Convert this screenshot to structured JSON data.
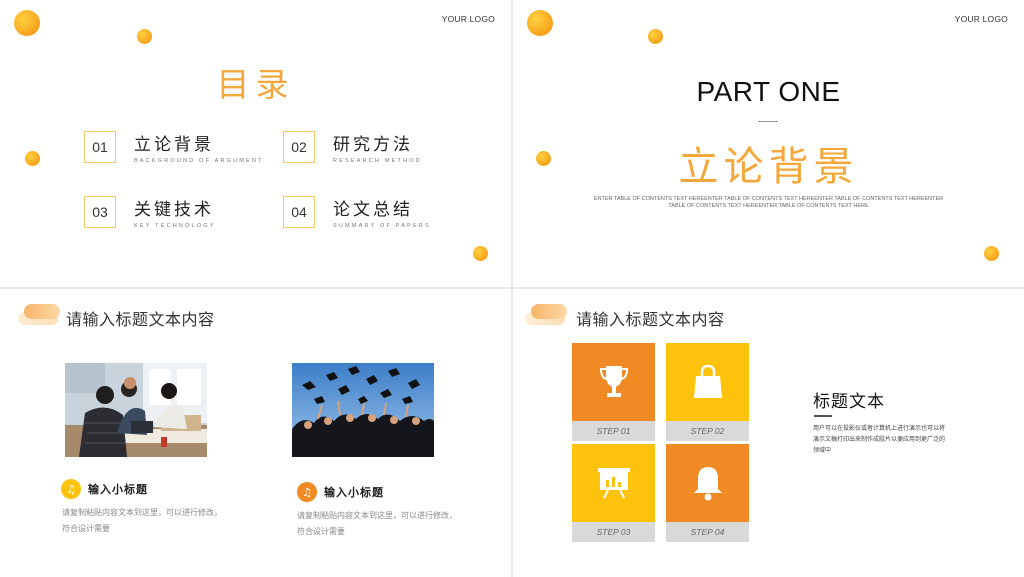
{
  "logo_text": "YOUR LOGO",
  "colors": {
    "accent": "#f4a73b",
    "orange": "#f08a24",
    "yellow": "#fdc20b",
    "grey_label": "#d9d9d9"
  },
  "slide1": {
    "title": "目录",
    "items": [
      {
        "num": "01",
        "label": "立论背景",
        "sub": "BACKGROUND OF ARGUMENT"
      },
      {
        "num": "02",
        "label": "研究方法",
        "sub": "RESEARCH METHOD"
      },
      {
        "num": "03",
        "label": "关键技术",
        "sub": "KEY TECHNOLOGY"
      },
      {
        "num": "04",
        "label": "论文总结",
        "sub": "SUMMARY OF PAPERS"
      }
    ]
  },
  "slide2": {
    "part": "PART ONE",
    "title": "立论背景",
    "desc": "ENTER TABLE OF CONTENTS TEXT HEREENTER TABLE OF CONTENTS TEXT HEREENTER TABLE OF CONTENTS TEXT HEREENTER TABLE OF CONTENTS TEXT HEREENTER TABLE OF CONTENTS TEXT HERE"
  },
  "slide3": {
    "header": "请输入标题文本内容",
    "cards": [
      {
        "icon": "music-note-icon",
        "title": "输入小标题",
        "desc": "请复制粘贴内容文本到这里，可以进行修改，符合设计需要"
      },
      {
        "icon": "music-note-icon",
        "title": "输入小标题",
        "desc": "请复制粘贴内容文本到这里，可以进行修改，符合设计需要"
      }
    ]
  },
  "slide4": {
    "header": "请输入标题文本内容",
    "steps": [
      {
        "label": "STEP 01",
        "icon": "trophy-icon"
      },
      {
        "label": "STEP 02",
        "icon": "shopping-bag-icon"
      },
      {
        "label": "STEP 03",
        "icon": "presentation-board-icon"
      },
      {
        "label": "STEP 04",
        "icon": "bell-icon"
      }
    ],
    "title": "标题文本",
    "desc": "用户可以在投影仪或者计算机上进行演示也可以将演示文稿打印出来制作成胶片以便应用到更广泛的领域中"
  }
}
